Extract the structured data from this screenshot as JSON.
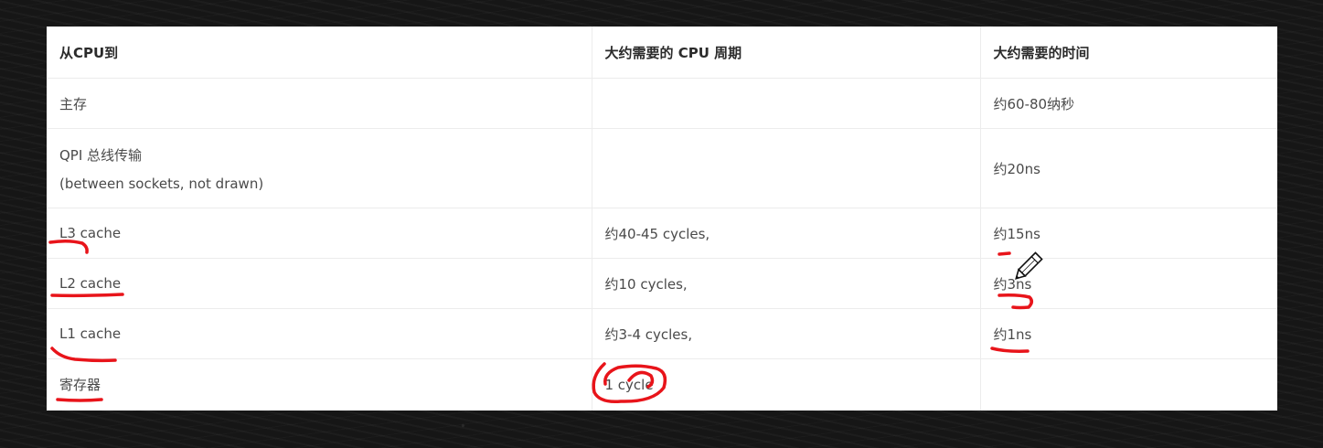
{
  "table": {
    "headers": [
      "从CPU到",
      "大约需要的 CPU 周期",
      "大约需要的时间"
    ],
    "rows": [
      {
        "target": "主存",
        "cycles": "",
        "time": "约60-80纳秒"
      },
      {
        "target_line1": "QPI 总线传输",
        "target_line2": "(between sockets, not drawn)",
        "cycles": "",
        "time": "约20ns"
      },
      {
        "target": "L3 cache",
        "cycles": "约40-45 cycles,",
        "time": "约15ns"
      },
      {
        "target": "L2 cache",
        "cycles": "约10 cycles,",
        "time": "约3ns"
      },
      {
        "target": "L1 cache",
        "cycles": "约3-4 cycles,",
        "time": "约1ns"
      },
      {
        "target": "寄存器",
        "cycles": "1 cycle",
        "time": ""
      }
    ]
  },
  "annotations": {
    "ink_color": "#e8141a",
    "cursor_icon": "pencil-cursor-icon"
  }
}
